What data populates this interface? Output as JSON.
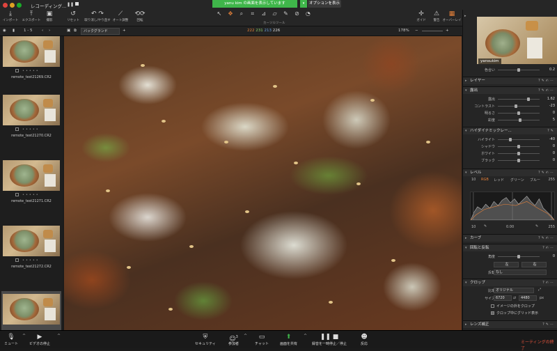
{
  "window": {
    "title": "レコーディング...",
    "dots": [
      "#e0443e",
      "#dea123",
      "#1aab29"
    ]
  },
  "zoom_share": {
    "banner": "yanu kim の画面を表示しています",
    "options_label": "オプションを表示"
  },
  "toolbar": {
    "left": [
      {
        "icon": "import-icon",
        "label": "インポート"
      },
      {
        "icon": "export-icon",
        "label": "エクスポート"
      },
      {
        "icon": "camera-icon",
        "label": "撮影"
      }
    ],
    "edit": [
      {
        "icon": "reset-icon",
        "label": "リセット"
      },
      {
        "icon": "undo-icon",
        "label": "取り消し/やり直す"
      },
      {
        "icon": "auto-adjust-icon",
        "label": "オート調整"
      },
      {
        "icon": "rotate-icon",
        "label": "回転"
      }
    ],
    "cursor_tools_label": "カーソルツール",
    "right": [
      {
        "icon": "guide-icon",
        "label": "ガイド"
      },
      {
        "icon": "warning-icon",
        "label": "警告"
      },
      {
        "icon": "overlay-icon",
        "label": "オーバーレイ"
      },
      {
        "icon": "grid-icon",
        "label": "グリッド"
      }
    ]
  },
  "viewer_bar": {
    "range": "1 - 5",
    "background_select": "バックグランド",
    "rgb_values": [
      "222",
      "231",
      "213",
      "226"
    ],
    "zoom": "178%"
  },
  "filmstrip": [
    {
      "name": "remote_test21269.CR2",
      "selected": false
    },
    {
      "name": "remote_test21270.CR2",
      "selected": false
    },
    {
      "name": "remote_test21271.CR2",
      "selected": false
    },
    {
      "name": "remote_test21272.CR2",
      "selected": false
    },
    {
      "name": "",
      "selected": true
    }
  ],
  "panel": {
    "preview_user": "yansukim",
    "tint": {
      "label": "色合い",
      "value": "0.2"
    },
    "layer_label": "レイヤー",
    "exposure": {
      "title": "露出",
      "rows": [
        {
          "label": "露出",
          "value": "1.62",
          "pos": 0.7
        },
        {
          "label": "コントラスト",
          "value": "-23",
          "pos": 0.4
        },
        {
          "label": "明るさ",
          "value": "0",
          "pos": 0.5
        },
        {
          "label": "彩度",
          "value": "5",
          "pos": 0.53
        }
      ]
    },
    "hdr": {
      "title": "ハイダイナミックレー...",
      "rows": [
        {
          "label": "ハイライト",
          "value": "-40",
          "pos": 0.3
        },
        {
          "label": "シャドウ",
          "value": "0",
          "pos": 0.5
        },
        {
          "label": "ホワイト",
          "value": "0",
          "pos": 0.5
        },
        {
          "label": "ブラック",
          "value": "0",
          "pos": 0.5
        }
      ]
    },
    "levels": {
      "title": "レベル",
      "min": "10",
      "tabs": [
        "RGB",
        "レッド",
        "グリーン",
        "ブルー"
      ],
      "max": "255",
      "out_min": "10",
      "mid": "0.00",
      "out_max": "255"
    },
    "curve_label": "カーブ",
    "rotation": {
      "title": "回転と反転",
      "angle_label": "角度",
      "angle_value": "0",
      "left_btn": "左",
      "right_btn": "右",
      "flip_label": "反転",
      "flip_value": "なし"
    },
    "crop": {
      "title": "クロップ",
      "ratio_label": "比率",
      "ratio_value": "オリジナル",
      "size_label": "サイズ",
      "width": "6720",
      "height": "4480",
      "unit": "px",
      "cb1": "イメージの外をクロップ",
      "cb2": "クロップ中にグリッド表示"
    },
    "lens_label": "レンズ補正"
  },
  "meeting_bar": {
    "mute": "ミュート",
    "video": "ビデオの停止",
    "security": "セキュリティ",
    "participants": "参加者",
    "participants_count": "3",
    "chat": "チャット",
    "share": "画面を共有",
    "record": "録音を一時停止／停止",
    "reactions": "反応",
    "end": "ミーティングの終了"
  }
}
